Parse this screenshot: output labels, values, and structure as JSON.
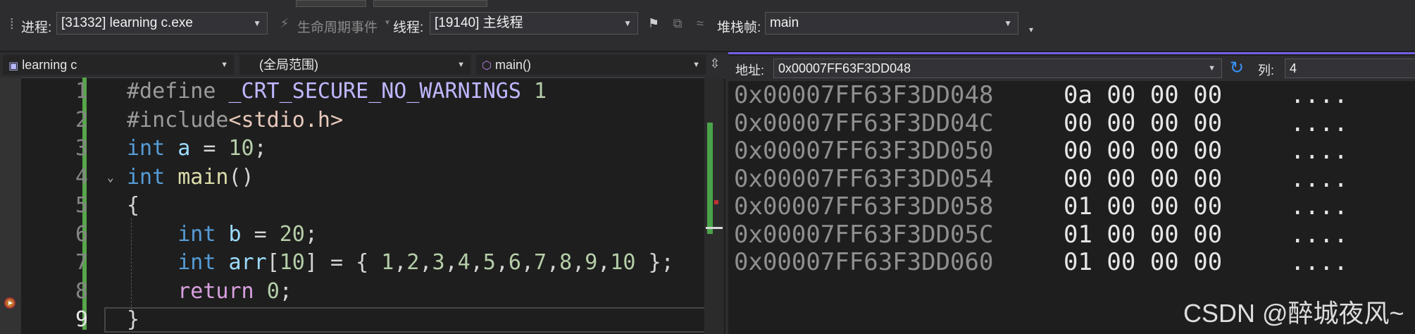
{
  "toolbar": {
    "process_label": "进程:",
    "process_value": "[31332] learning c.exe",
    "lifecycle_label": "生命周期事件",
    "thread_label": "线程:",
    "thread_value": "[19140] 主线程",
    "stackframe_label": "堆栈帧:",
    "stackframe_value": "main"
  },
  "editor_nav": {
    "project": "learning c",
    "scope": "(全局范围)",
    "function": "main()"
  },
  "code": {
    "line_numbers": [
      "1",
      "2",
      "3",
      "4",
      "5",
      "6",
      "7",
      "8",
      "9"
    ],
    "current_line": "9",
    "lines": [
      [
        [
          "pp",
          "#define "
        ],
        [
          "mac",
          "_CRT_SECURE_NO_WARNINGS"
        ],
        [
          "pl",
          " "
        ],
        [
          "num",
          "1"
        ]
      ],
      [
        [
          "pp",
          "#include"
        ],
        [
          "str",
          "<stdio.h>"
        ]
      ],
      [
        [
          "kw",
          "int"
        ],
        [
          "pl",
          " "
        ],
        [
          "var",
          "a"
        ],
        [
          "pl",
          " = "
        ],
        [
          "num",
          "10"
        ],
        [
          "pl",
          ";"
        ]
      ],
      [
        [
          "kw",
          "int"
        ],
        [
          "pl",
          " "
        ],
        [
          "fn",
          "main"
        ],
        [
          "pl",
          "()"
        ]
      ],
      [
        [
          "pl",
          "{"
        ]
      ],
      [
        [
          "pl",
          "    "
        ],
        [
          "kw",
          "int"
        ],
        [
          "pl",
          " "
        ],
        [
          "var",
          "b"
        ],
        [
          "pl",
          " = "
        ],
        [
          "num",
          "20"
        ],
        [
          "pl",
          ";"
        ]
      ],
      [
        [
          "pl",
          "    "
        ],
        [
          "kw",
          "int"
        ],
        [
          "pl",
          " "
        ],
        [
          "var",
          "arr"
        ],
        [
          "pl",
          "["
        ],
        [
          "num",
          "10"
        ],
        [
          "pl",
          "] = { "
        ],
        [
          "num",
          "1"
        ],
        [
          "pl",
          ","
        ],
        [
          "num",
          "2"
        ],
        [
          "pl",
          ","
        ],
        [
          "num",
          "3"
        ],
        [
          "pl",
          ","
        ],
        [
          "num",
          "4"
        ],
        [
          "pl",
          ","
        ],
        [
          "num",
          "5"
        ],
        [
          "pl",
          ","
        ],
        [
          "num",
          "6"
        ],
        [
          "pl",
          ","
        ],
        [
          "num",
          "7"
        ],
        [
          "pl",
          ","
        ],
        [
          "num",
          "8"
        ],
        [
          "pl",
          ","
        ],
        [
          "num",
          "9"
        ],
        [
          "pl",
          ","
        ],
        [
          "num",
          "10"
        ],
        [
          "pl",
          " };"
        ]
      ],
      [
        [
          "pl",
          "    "
        ],
        [
          "ctl",
          "return"
        ],
        [
          "pl",
          " "
        ],
        [
          "num",
          "0"
        ],
        [
          "pl",
          ";"
        ]
      ],
      [
        [
          "pl",
          "}"
        ]
      ]
    ]
  },
  "memory": {
    "address_label": "地址:",
    "address_value": "0x00007FF63F3DD048",
    "columns_label": "列:",
    "columns_value": "4",
    "rows": [
      {
        "address": "0x00007FF63F3DD048",
        "bytes": "0a 00 00 00",
        "ascii": "...."
      },
      {
        "address": "0x00007FF63F3DD04C",
        "bytes": "00 00 00 00",
        "ascii": "...."
      },
      {
        "address": "0x00007FF63F3DD050",
        "bytes": "00 00 00 00",
        "ascii": "...."
      },
      {
        "address": "0x00007FF63F3DD054",
        "bytes": "00 00 00 00",
        "ascii": "...."
      },
      {
        "address": "0x00007FF63F3DD058",
        "bytes": "01 00 00 00",
        "ascii": "...."
      },
      {
        "address": "0x00007FF63F3DD05C",
        "bytes": "01 00 00 00",
        "ascii": "...."
      },
      {
        "address": "0x00007FF63F3DD060",
        "bytes": "01 00 00 00",
        "ascii": "...."
      }
    ]
  },
  "watermark": "CSDN @醉城夜风~",
  "colors": {
    "background": "#1e1e1e",
    "toolbar": "#2d2d30",
    "change_bar": "#57a64a",
    "memory_accent": "#7160e8",
    "keyword": "#569cd6",
    "number": "#b5cea8"
  }
}
